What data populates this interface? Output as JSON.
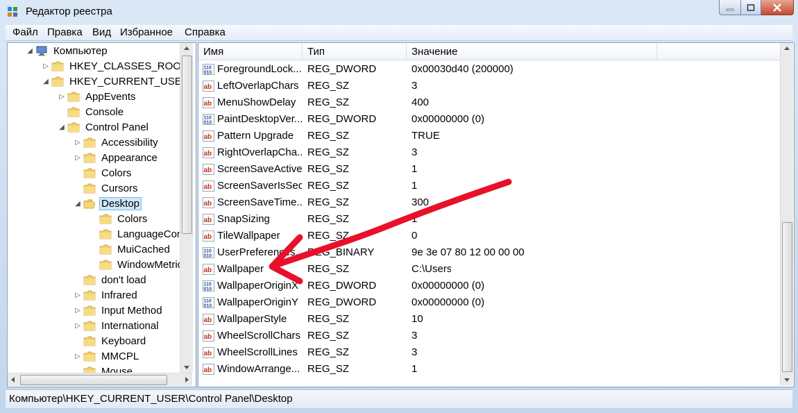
{
  "window": {
    "title": "Редактор реестра",
    "icon": "regedit-icon"
  },
  "menu": [
    "Файл",
    "Правка",
    "Вид",
    "Избранное",
    "Справка"
  ],
  "tree": [
    {
      "label": "Компьютер",
      "level": 0,
      "expander": "expanded",
      "icon": "computer-icon"
    },
    {
      "label": "HKEY_CLASSES_ROOT",
      "level": 1,
      "expander": "collapsed",
      "icon": "folder-icon"
    },
    {
      "label": "HKEY_CURRENT_USER",
      "level": 1,
      "expander": "expanded",
      "icon": "folder-icon"
    },
    {
      "label": "AppEvents",
      "level": 2,
      "expander": "collapsed",
      "icon": "folder-icon"
    },
    {
      "label": "Console",
      "level": 2,
      "expander": "none",
      "icon": "folder-icon"
    },
    {
      "label": "Control Panel",
      "level": 2,
      "expander": "expanded",
      "icon": "folder-icon"
    },
    {
      "label": "Accessibility",
      "level": 3,
      "expander": "collapsed",
      "icon": "folder-icon"
    },
    {
      "label": "Appearance",
      "level": 3,
      "expander": "collapsed",
      "icon": "folder-icon"
    },
    {
      "label": "Colors",
      "level": 3,
      "expander": "none",
      "icon": "folder-icon"
    },
    {
      "label": "Cursors",
      "level": 3,
      "expander": "none",
      "icon": "folder-icon"
    },
    {
      "label": "Desktop",
      "level": 3,
      "expander": "expanded",
      "icon": "folder-open-icon",
      "selected": true
    },
    {
      "label": "Colors",
      "level": 4,
      "expander": "none",
      "icon": "folder-icon"
    },
    {
      "label": "LanguageConfig",
      "level": 4,
      "expander": "none",
      "icon": "folder-icon"
    },
    {
      "label": "MuiCached",
      "level": 4,
      "expander": "none",
      "icon": "folder-icon"
    },
    {
      "label": "WindowMetrics",
      "level": 4,
      "expander": "none",
      "icon": "folder-icon"
    },
    {
      "label": "don't load",
      "level": 3,
      "expander": "none",
      "icon": "folder-icon"
    },
    {
      "label": "Infrared",
      "level": 3,
      "expander": "collapsed",
      "icon": "folder-icon"
    },
    {
      "label": "Input Method",
      "level": 3,
      "expander": "collapsed",
      "icon": "folder-icon"
    },
    {
      "label": "International",
      "level": 3,
      "expander": "collapsed",
      "icon": "folder-icon"
    },
    {
      "label": "Keyboard",
      "level": 3,
      "expander": "none",
      "icon": "folder-icon"
    },
    {
      "label": "MMCPL",
      "level": 3,
      "expander": "collapsed",
      "icon": "folder-icon"
    },
    {
      "label": "Mouse",
      "level": 3,
      "expander": "none",
      "icon": "folder-icon"
    }
  ],
  "list": {
    "columns": [
      "Имя",
      "Тип",
      "Значение"
    ],
    "rows": [
      {
        "name": "ForegroundLock...",
        "type": "REG_DWORD",
        "value": "0x00030d40 (200000)",
        "icon": "binary-value-icon"
      },
      {
        "name": "LeftOverlapChars",
        "type": "REG_SZ",
        "value": "3",
        "icon": "string-value-icon"
      },
      {
        "name": "MenuShowDelay",
        "type": "REG_SZ",
        "value": "400",
        "icon": "string-value-icon"
      },
      {
        "name": "PaintDesktopVer...",
        "type": "REG_DWORD",
        "value": "0x00000000 (0)",
        "icon": "binary-value-icon"
      },
      {
        "name": "Pattern Upgrade",
        "type": "REG_SZ",
        "value": "TRUE",
        "icon": "string-value-icon"
      },
      {
        "name": "RightOverlapCha...",
        "type": "REG_SZ",
        "value": "3",
        "icon": "string-value-icon"
      },
      {
        "name": "ScreenSaveActive",
        "type": "REG_SZ",
        "value": "1",
        "icon": "string-value-icon"
      },
      {
        "name": "ScreenSaverIsSec...",
        "type": "REG_SZ",
        "value": "1",
        "icon": "string-value-icon"
      },
      {
        "name": "ScreenSaveTime...",
        "type": "REG_SZ",
        "value": "300",
        "icon": "string-value-icon"
      },
      {
        "name": "SnapSizing",
        "type": "REG_SZ",
        "value": "1",
        "icon": "string-value-icon"
      },
      {
        "name": "TileWallpaper",
        "type": "REG_SZ",
        "value": "0",
        "icon": "string-value-icon"
      },
      {
        "name": "UserPreferences...",
        "type": "REG_BINARY",
        "value": "9e 3e 07 80 12 00 00 00",
        "icon": "binary-value-icon"
      },
      {
        "name": "Wallpaper",
        "type": "REG_SZ",
        "value": "C:\\Users\\",
        "icon": "string-value-icon"
      },
      {
        "name": "WallpaperOriginX",
        "type": "REG_DWORD",
        "value": "0x00000000 (0)",
        "icon": "binary-value-icon"
      },
      {
        "name": "WallpaperOriginY",
        "type": "REG_DWORD",
        "value": "0x00000000 (0)",
        "icon": "binary-value-icon"
      },
      {
        "name": "WallpaperStyle",
        "type": "REG_SZ",
        "value": "10",
        "icon": "string-value-icon"
      },
      {
        "name": "WheelScrollChars",
        "type": "REG_SZ",
        "value": "3",
        "icon": "string-value-icon"
      },
      {
        "name": "WheelScrollLines",
        "type": "REG_SZ",
        "value": "3",
        "icon": "string-value-icon"
      },
      {
        "name": "WindowArrange...",
        "type": "REG_SZ",
        "value": "1",
        "icon": "string-value-icon"
      }
    ]
  },
  "status": {
    "path": "Компьютер\\HKEY_CURRENT_USER\\Control Panel\\Desktop"
  },
  "annotation": {
    "color": "#e8102a",
    "icon": "red-arrow-annotation-icon"
  }
}
